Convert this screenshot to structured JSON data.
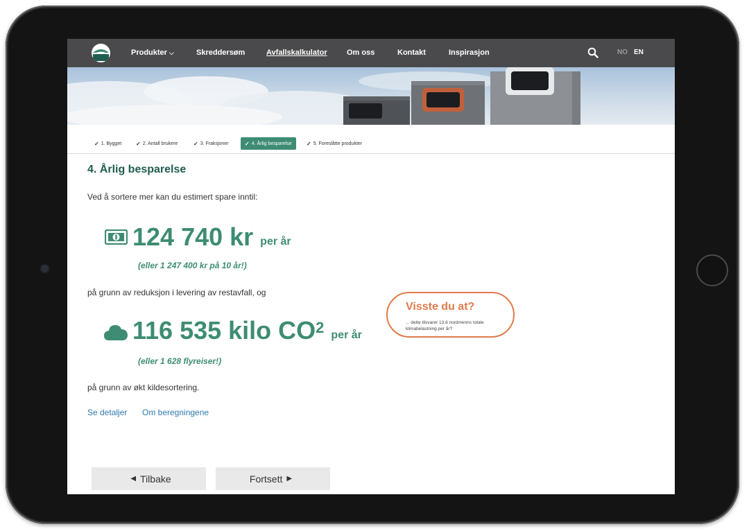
{
  "nav": {
    "items": [
      {
        "label": "Produkter",
        "has_dropdown": true
      },
      {
        "label": "Skreddersøm"
      },
      {
        "label": "Avfallskalkulator",
        "active": true
      },
      {
        "label": "Om oss"
      },
      {
        "label": "Kontakt"
      },
      {
        "label": "Inspirasjon"
      }
    ],
    "languages": [
      "NO",
      "EN"
    ],
    "selected_language": "EN"
  },
  "steps": [
    {
      "label": "1. Bygget",
      "done": true
    },
    {
      "label": "2. Antall brukere",
      "done": true
    },
    {
      "label": "3. Fraksjoner",
      "done": true
    },
    {
      "label": "4. Årlig besparelse",
      "done": true,
      "active": true
    },
    {
      "label": "5. Foreslåtte produkter",
      "done": true
    }
  ],
  "content": {
    "title": "4. Årlig besparelse",
    "intro": "Ved å sortere mer kan du estimert spare inntil:",
    "money": {
      "value": "124 740 kr",
      "unit": "per år",
      "sub": "(eller 1 247 400 kr på 10 år!)"
    },
    "reason1": "på grunn av reduksjon i levering av restavfall, og",
    "co2": {
      "value": "116 535 kilo CO",
      "superscript": "2",
      "unit": "per år",
      "sub": "(eller 1 628 flyreiser!)"
    },
    "reason2": "på grunn av økt kildesortering.",
    "links": [
      "Se detaljer",
      "Om beregningene"
    ],
    "did_you_know": {
      "title": "Visste du at?",
      "text": "... dette tilsvarer 13,6 nordmenns totale klimabelastning per år?"
    }
  },
  "buttons": {
    "back": "Tilbake",
    "next": "Fortsett"
  },
  "colors": {
    "brand_green": "#3d8c73",
    "title_green": "#215d50",
    "nav_bg": "#4a4a4c",
    "accent_orange": "#e07a4b",
    "link_blue": "#2e7ab0"
  }
}
